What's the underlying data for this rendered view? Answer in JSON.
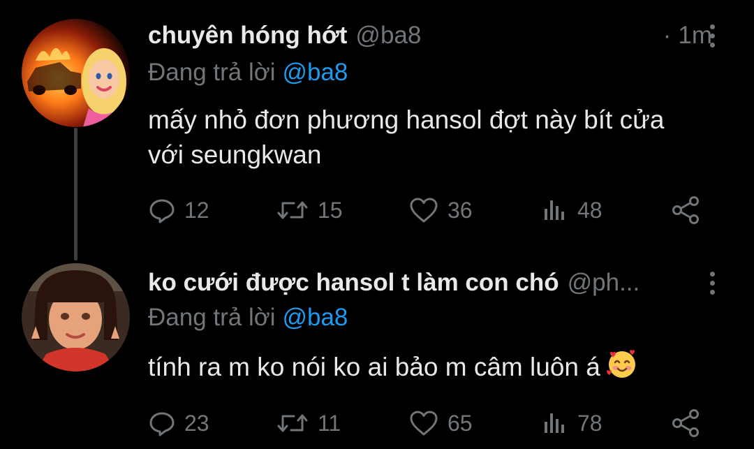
{
  "tweets": [
    {
      "display_name": "chuyên hóng hớt",
      "handle": "@ba8",
      "separator": "·",
      "time": "1m",
      "reply_prefix": "Đang trả lời",
      "reply_to": "@ba8",
      "text_line1": "mấy nhỏ đơn phương hansol đợt này bít cửa",
      "text_line2": "với seungkwan",
      "stats": {
        "replies": "12",
        "retweets": "15",
        "likes": "36",
        "views": "48"
      }
    },
    {
      "display_name": "ko cưới được hansol t làm con chó",
      "handle": "@ph...",
      "reply_prefix": "Đang trả lời",
      "reply_to": "@ba8",
      "text": "tính ra m ko nói ko ai bảo m câm luôn á",
      "emoji": "smiling-face-with-hearts",
      "stats": {
        "replies": "23",
        "retweets": "11",
        "likes": "65",
        "views": "78"
      }
    }
  ],
  "icons": {
    "reply": "reply-icon",
    "retweet": "retweet-icon",
    "like": "heart-icon",
    "views": "views-icon",
    "share": "share-icon",
    "more": "more-vertical-icon"
  },
  "colors": {
    "background": "#000000",
    "text": "#e7e9ea",
    "muted": "#71767b",
    "link": "#1d9bf0"
  }
}
